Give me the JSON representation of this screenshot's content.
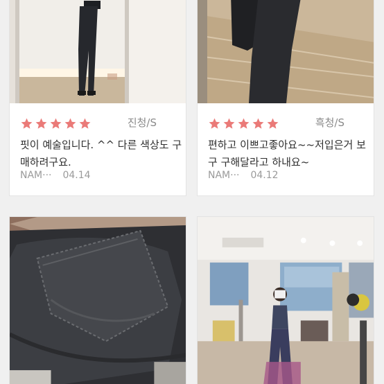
{
  "colors": {
    "star": "#ea7a78",
    "text": "#2f2f2f",
    "muted": "#9a9a9a",
    "background": "#f0f0f0"
  },
  "reviews": [
    {
      "rating": 5,
      "option": "진청/S",
      "text": "핏이 예술입니다. ^^ 다른 색상도 구매하려구요.",
      "author": "NAM···",
      "date": "04.14"
    },
    {
      "rating": 5,
      "option": "흑청/S",
      "text": "편하고 이쁘고좋아요~~저입은거 보구 구해달라고 하내요~",
      "author": "NAM···",
      "date": "04.12"
    }
  ],
  "bottom_photos": [
    {
      "description_icon": "jeans-pocket-photo"
    },
    {
      "description_icon": "gym-mirror-selfie-photo"
    }
  ]
}
